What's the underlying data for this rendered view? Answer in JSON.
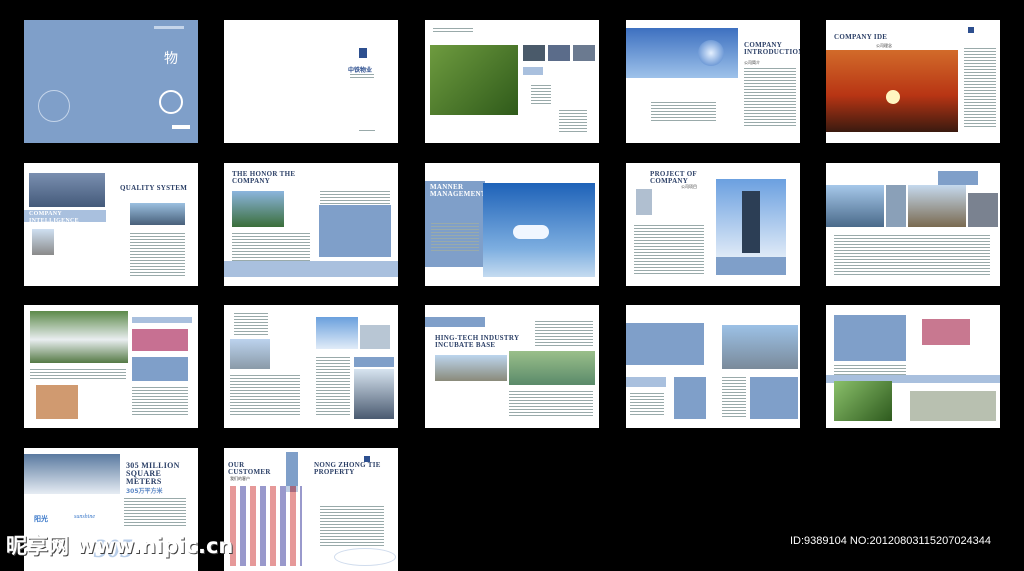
{
  "pages": [
    {
      "id": "cover"
    },
    {
      "id": "title-page",
      "brand": "中铁物业"
    },
    {
      "id": "contents"
    },
    {
      "id": "company-intro",
      "title": "COMPANY INTRODUCTION",
      "subtitle": "公司简介"
    },
    {
      "id": "company-idea",
      "title": "COMPANY IDE",
      "subtitle": "公司理念"
    },
    {
      "id": "quality",
      "title": "QUALITY SYSTEM",
      "side": "COMPANY INTELLIGENCE"
    },
    {
      "id": "honor",
      "title": "THE HONOR THE COMPANY"
    },
    {
      "id": "manner",
      "title": "MANNER MANAGEMENT"
    },
    {
      "id": "project",
      "title": "PROJECT OF COMPANY",
      "subtitle": "公司项目"
    },
    {
      "id": "buildings"
    },
    {
      "id": "waterfall"
    },
    {
      "id": "towers"
    },
    {
      "id": "hing-tech",
      "title": "HING-TECH INDUSTRY INCUBATE BASE"
    },
    {
      "id": "blue-blocks"
    },
    {
      "id": "flowers"
    },
    {
      "id": "million",
      "title": "305 MILLION SQUARE METERS",
      "subtitle": "305万平方米",
      "sun": "阳光",
      "sunEn": "sunshine"
    },
    {
      "id": "customers",
      "title": "OUR CUSTOMER",
      "subtitle": "我们的客户",
      "right": "NONG ZHONG TIE PROPERTY"
    }
  ],
  "watermark": "昵享网 www.nipic.cn",
  "footer": "ID:9389104 NO:20120803115207024344"
}
